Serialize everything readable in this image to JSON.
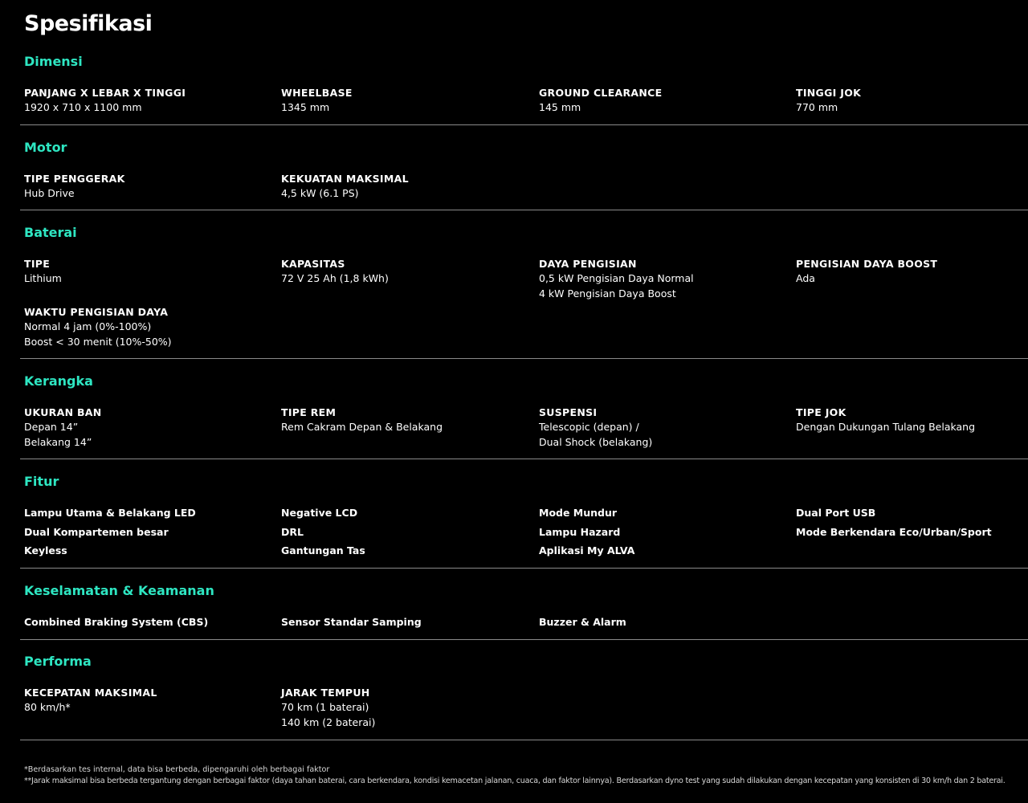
{
  "page_title": "Spesifikasi",
  "accent_color": "#2ee6c2",
  "sections": {
    "dimensi": {
      "title": "Dimensi",
      "specs": [
        {
          "label": "PANJANG X LEBAR X TINGGI",
          "value": "1920 x 710 x 1100 mm"
        },
        {
          "label": "WHEELBASE",
          "value": "1345 mm"
        },
        {
          "label": "GROUND CLEARANCE",
          "value": "145 mm"
        },
        {
          "label": "TINGGI JOK",
          "value": "770 mm"
        }
      ]
    },
    "motor": {
      "title": "Motor",
      "specs": [
        {
          "label": "TIPE PENGGERAK",
          "value": "Hub Drive"
        },
        {
          "label": "KEKUATAN MAKSIMAL",
          "value": "4,5 kW (6.1 PS)"
        }
      ]
    },
    "baterai": {
      "title": "Baterai",
      "specs": [
        {
          "label": "TIPE",
          "value": "Lithium"
        },
        {
          "label": "KAPASITAS",
          "value": "72 V 25 Ah (1,8 kWh)"
        },
        {
          "label": "DAYA PENGISIAN",
          "value": "0,5 kW Pengisian Daya Normal\n4 kW Pengisian Daya Boost"
        },
        {
          "label": "PENGISIAN DAYA BOOST",
          "value": "Ada"
        },
        {
          "label": "WAKTU PENGISIAN DAYA",
          "value": "Normal 4 jam (0%-100%)\nBoost < 30 menit (10%-50%)"
        }
      ]
    },
    "kerangka": {
      "title": "Kerangka",
      "specs": [
        {
          "label": "UKURAN BAN",
          "value": "Depan 14”\nBelakang 14”"
        },
        {
          "label": "TIPE REM",
          "value": "Rem Cakram Depan & Belakang"
        },
        {
          "label": "SUSPENSI",
          "value": "Telescopic (depan) /\nDual Shock (belakang)"
        },
        {
          "label": "TIPE JOK",
          "value": "Dengan Dukungan Tulang Belakang"
        }
      ]
    },
    "fitur": {
      "title": "Fitur",
      "items": [
        "Lampu Utama & Belakang LED",
        "Negative LCD",
        "Mode Mundur",
        "Dual Port USB",
        "Dual Kompartemen besar",
        "DRL",
        "Lampu Hazard",
        "Mode Berkendara Eco/Urban/Sport",
        "Keyless",
        "Gantungan Tas",
        "Aplikasi My ALVA"
      ]
    },
    "keselamatan": {
      "title": "Keselamatan & Keamanan",
      "items": [
        "Combined Braking System (CBS)",
        "Sensor Standar Samping",
        "Buzzer & Alarm"
      ]
    },
    "performa": {
      "title": "Performa",
      "specs": [
        {
          "label": "KECEPATAN MAKSIMAL",
          "value": "80 km/h*"
        },
        {
          "label": "JARAK TEMPUH",
          "value": "70 km (1 baterai)\n140 km (2 baterai)"
        }
      ]
    }
  },
  "footnotes": [
    "*Berdasarkan tes internal, data bisa berbeda, dipengaruhi oleh berbagai faktor",
    "**Jarak maksimal bisa berbeda tergantung dengan berbagai faktor (daya tahan baterai, cara berkendara, kondisi kemacetan jalanan, cuaca, dan faktor lainnya). Berdasarkan dyno test yang sudah dilakukan dengan kecepatan yang konsisten di 30 km/h dan 2 baterai."
  ]
}
